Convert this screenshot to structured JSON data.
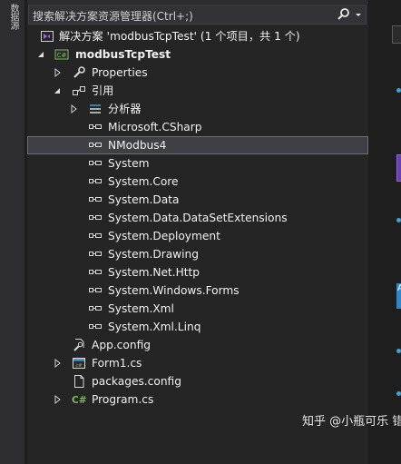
{
  "side_tab": {
    "label": "数据源"
  },
  "search": {
    "text": "搜索解决方案资源管理器(Ctrl+;)"
  },
  "tree": {
    "solution": "解决方案 'modbusTcpTest' (1 个项目，共 1 个)",
    "project": "modbusTcpTest",
    "project_badge": "C#",
    "properties": "Properties",
    "references": "引用",
    "analyzers": "分析器",
    "refs": [
      "Microsoft.CSharp",
      "NModbus4",
      "System",
      "System.Core",
      "System.Data",
      "System.Data.DataSetExtensions",
      "System.Deployment",
      "System.Drawing",
      "System.Net.Http",
      "System.Windows.Forms",
      "System.Xml",
      "System.Xml.Linq"
    ],
    "selected_ref": "NModbus4",
    "files": {
      "app_config": "App.config",
      "form1": "Form1.cs",
      "packages": "packages.config",
      "program": "Program.cs",
      "program_badge": "C#"
    }
  },
  "watermark": "知乎 @小瓶可乐 错"
}
